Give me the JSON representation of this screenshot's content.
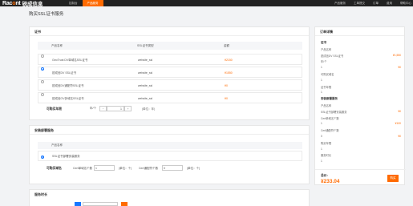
{
  "header": {
    "logo_en_1": "Rac",
    "logo_en_o": "o",
    "logo_en_2": "nt",
    "logo_cn": "锐成信息",
    "nav": [
      "控制台",
      "产品服务"
    ],
    "active_nav": "产品服务",
    "right": [
      "产品服务",
      "工单提交",
      "订单",
      "费用",
      "帮助中心"
    ]
  },
  "page": {
    "title": "购买SSL证书服务"
  },
  "cert": {
    "section_title": "证书",
    "columns": [
      "产品名称",
      "SSL证书类型",
      "金额"
    ],
    "rows": [
      {
        "name": "GeoTrust DV单域名SSL证书",
        "type": "website_ssl",
        "price": "¥2150",
        "selected": false
      },
      {
        "name": "锐成信DV SSL证书",
        "type": "website_ssl",
        "price": "¥1550",
        "selected": true
      },
      {
        "name": "锐成信DV通配符SSL证书",
        "type": "website_ssl",
        "price": "¥0",
        "selected": false
      },
      {
        "name": "锐成信OV多域名SSL证书",
        "type": "website_ssl",
        "price": "¥0",
        "selected": false
      }
    ],
    "period_label": "可购买年限",
    "period_unit": "年/个",
    "period_value": "1",
    "period_minus": "−",
    "period_plus": "+",
    "period_note": "(单位：年)"
  },
  "install": {
    "section_title": "安装部署服务",
    "column": "产品名称",
    "row_name": "SSL证书部署安装服务",
    "domain_label": "可购买域名",
    "field1_label": "Cert单域名个数",
    "field1_value": "1",
    "field1_note": "(单位：个)",
    "field2_label": "Cert通配符个数",
    "field2_value": "0",
    "field2_note": "(单位：个)"
  },
  "next": {
    "section_title": "服务时长"
  },
  "order": {
    "title": "订单详情",
    "lines": [
      {
        "text": "证书",
        "right": "",
        "head": true
      },
      {
        "text": "产品名称",
        "right": ""
      },
      {
        "text": "锐成信DV SSL证书",
        "right": "¥1,550"
      },
      {
        "text": "年/个",
        "right": ""
      },
      {
        "text": "1",
        "right": "¥0"
      },
      {
        "text": "可购买域名",
        "right": ""
      },
      {
        "text": "1",
        "right": ""
      },
      {
        "text": "证书年限",
        "right": ""
      },
      {
        "text": "1",
        "right": ""
      },
      {
        "text": "安装部署服务",
        "right": "",
        "head": true
      },
      {
        "text": "产品名称",
        "right": ""
      },
      {
        "text": "SSL证书部署安装服务",
        "right": "¥0"
      },
      {
        "text": "Cert单域名个数",
        "right": ""
      },
      {
        "text": "1",
        "right": "¥100"
      },
      {
        "text": "Cert通配符个数",
        "right": ""
      },
      {
        "text": "0",
        "right": "¥0"
      },
      {
        "text": "购买年限",
        "right": ""
      },
      {
        "text": "1",
        "right": ""
      },
      {
        "text": "服务时长",
        "right": ""
      },
      {
        "text": "1",
        "right": ""
      }
    ],
    "total_label": "总价:",
    "total_amount": "¥233.04",
    "buy_label": "购买"
  },
  "colors": {
    "accent": "#ff6a00",
    "topbar": "#222222",
    "radio": "#1677ff"
  }
}
